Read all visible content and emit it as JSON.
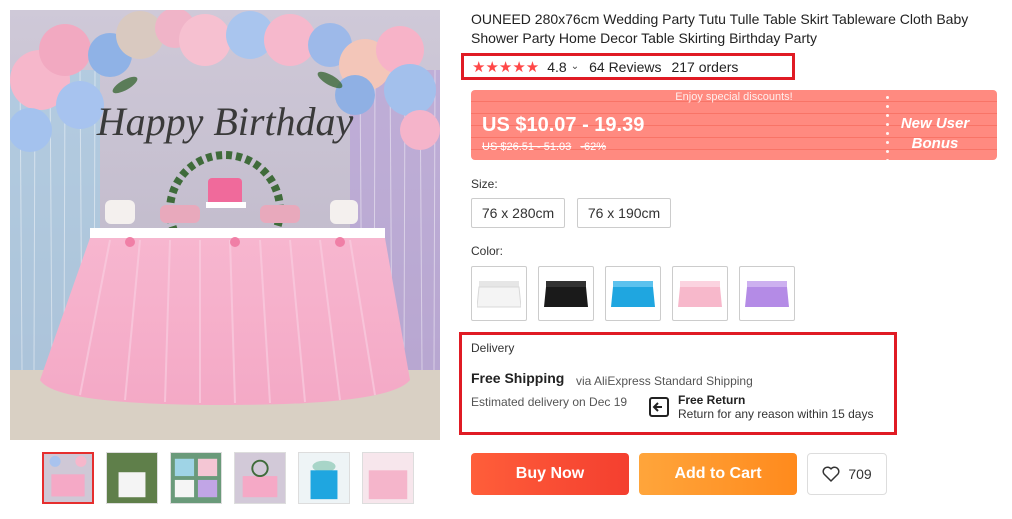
{
  "product": {
    "title": "OUNEED 280x76cm Wedding Party Tutu Tulle Table Skirt Tableware Cloth Baby Shower Party Home Decor Table Skirting Birthday Party",
    "main_image_icon": "pink-tutu-table-skirt-photo",
    "main_image_text": "Happy Birthday"
  },
  "rating": {
    "stars": "★★★★★",
    "value": "4.8",
    "chevron": "⌄",
    "reviews": "64 Reviews",
    "orders": "217 orders"
  },
  "price": {
    "banner": "Enjoy special discounts!",
    "range": "US $10.07 - 19.39",
    "original": "US $26.51 - 51.03",
    "discount": "-62%",
    "new_user_line1": "New User",
    "new_user_line2": "Bonus"
  },
  "size": {
    "label": "Size:",
    "options": [
      "76 x 280cm",
      "76 x 190cm"
    ]
  },
  "color": {
    "label": "Color:",
    "swatches": [
      {
        "name": "white",
        "hex": "#f2f2f2"
      },
      {
        "name": "black",
        "hex": "#1a1a1a"
      },
      {
        "name": "blue",
        "hex": "#1fa6e0"
      },
      {
        "name": "pink",
        "hex": "#f7b8cb"
      },
      {
        "name": "purple",
        "hex": "#b48be6"
      }
    ]
  },
  "delivery": {
    "label": "Delivery",
    "free_shipping": "Free Shipping",
    "via": "via AliExpress Standard Shipping",
    "estimated": "Estimated delivery on Dec 19",
    "return_title": "Free Return",
    "return_sub": "Return for any reason within 15 days"
  },
  "actions": {
    "buy_now": "Buy Now",
    "add_to_cart": "Add to Cart",
    "wishlist_count": "709"
  },
  "colors": {
    "accent_red": "#e01b24",
    "buy_now": "#f5462f",
    "add_to_cart": "#ff9a2b",
    "price_bg": "#ff8a80"
  }
}
